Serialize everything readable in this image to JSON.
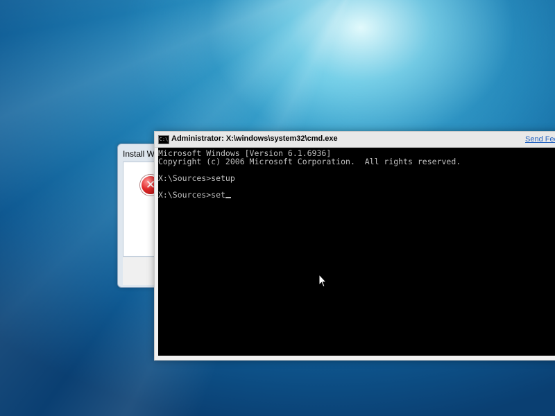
{
  "install_dialog": {
    "title": "Install W"
  },
  "cmd": {
    "title": "Administrator: X:\\windows\\system32\\cmd.exe",
    "icon_label": "C:\\",
    "send_feedback": "Send Fee",
    "lines": [
      "Microsoft Windows [Version 6.1.6936]",
      "Copyright (c) 2006 Microsoft Corporation.  All rights reserved.",
      "",
      "X:\\Sources>setup",
      "",
      "X:\\Sources>set"
    ]
  },
  "icons": {
    "error": "error-icon",
    "cmd": "cmd-icon",
    "pointer": "mouse-pointer-icon"
  }
}
